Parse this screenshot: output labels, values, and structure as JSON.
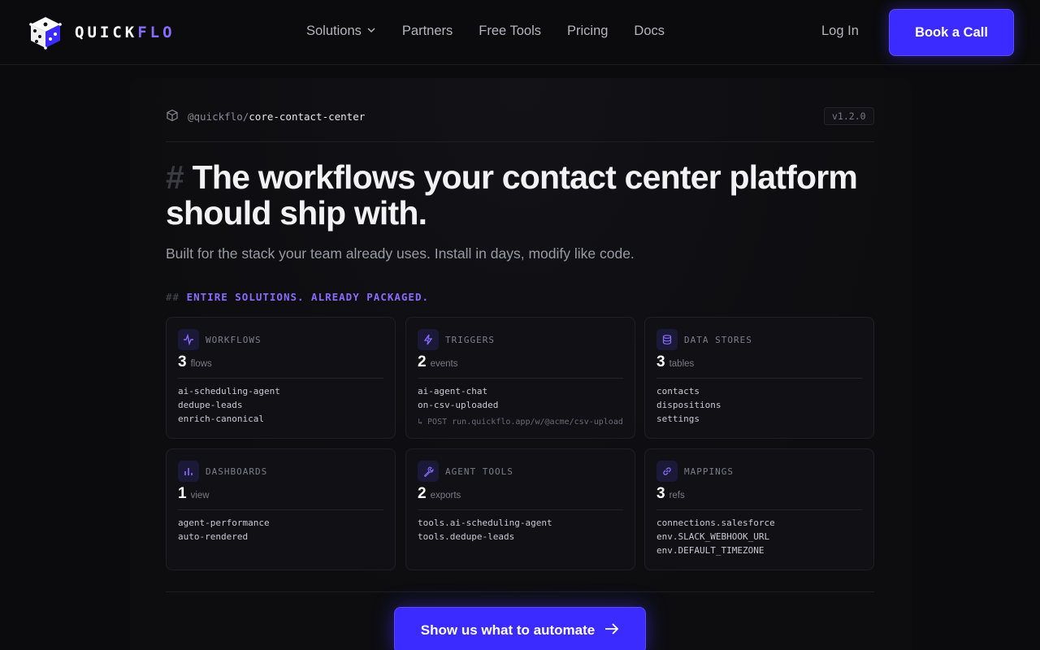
{
  "brand": {
    "name_main": "QUICK",
    "name_accent": "FLO",
    "accent_color": "#8a6bff",
    "button_color": "#3b2bff"
  },
  "nav": {
    "links": [
      "Solutions",
      "Partners",
      "Free Tools",
      "Pricing",
      "Docs"
    ],
    "login": "Log In",
    "cta": "Book a Call"
  },
  "package": {
    "prefix": "@quickflo/",
    "name": "core-contact-center",
    "version": "v1.2.0"
  },
  "hero": {
    "hash": "#",
    "headline": "The workflows your contact center platform should ship with.",
    "subhead": "Built for the stack your team already uses. Install in days, modify like code."
  },
  "section": {
    "prefix": "##",
    "label": "ENTIRE SOLUTIONS. ALREADY PACKAGED."
  },
  "cards": [
    {
      "title": "WORKFLOWS",
      "icon": "activity-icon",
      "count": "3",
      "unit": "flows",
      "items": [
        "ai-scheduling-agent",
        "dedupe-leads",
        "enrich-canonical"
      ],
      "note": ""
    },
    {
      "title": "TRIGGERS",
      "icon": "lightning-icon",
      "count": "2",
      "unit": "events",
      "items": [
        "ai-agent-chat",
        "on-csv-uploaded"
      ],
      "note": "↳ POST run.quickflo.app/w/@acme/csv-upload"
    },
    {
      "title": "DATA STORES",
      "icon": "database-icon",
      "count": "3",
      "unit": "tables",
      "items": [
        "contacts",
        "dispositions",
        "settings"
      ],
      "note": ""
    },
    {
      "title": "DASHBOARDS",
      "icon": "bar-chart-icon",
      "count": "1",
      "unit": "view",
      "items": [
        "agent-performance",
        "auto-rendered"
      ],
      "note": ""
    },
    {
      "title": "AGENT TOOLS",
      "icon": "wrench-icon",
      "count": "2",
      "unit": "exports",
      "items": [
        "tools.ai-scheduling-agent",
        "tools.dedupe-leads"
      ],
      "note": ""
    },
    {
      "title": "MAPPINGS",
      "icon": "link-icon",
      "count": "3",
      "unit": "refs",
      "items": [
        "connections.salesforce",
        "env.SLACK_WEBHOOK_URL",
        "env.DEFAULT_TIMEZONE"
      ],
      "note": ""
    }
  ],
  "cta_bottom": "Show us what to automate"
}
